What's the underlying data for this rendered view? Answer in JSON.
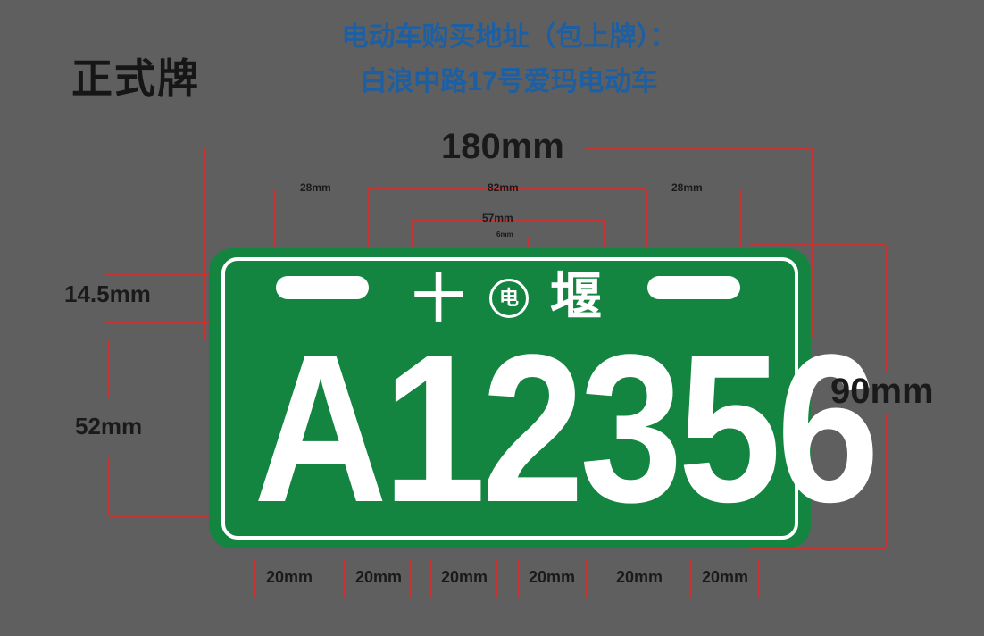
{
  "header": {
    "title": "正式牌",
    "banner_line1": "电动车购买地址（包上牌）：",
    "banner_line2": "白浪中路17号爱玛电动车"
  },
  "dimensions": {
    "width_total": "180mm",
    "height_total": "90mm",
    "slot_left": "28mm",
    "slot_gap": "82mm",
    "slot_right": "28mm",
    "top_text_span": "57mm",
    "circle_width": "6mm",
    "top_margin": "14.5mm",
    "char_height": "52mm",
    "char_widths": [
      "20mm",
      "20mm",
      "20mm",
      "20mm",
      "20mm",
      "20mm"
    ]
  },
  "plate": {
    "top_left_char": "十",
    "circle_char": "电",
    "top_right_char": "堰",
    "number": "A12356",
    "background_color": "#138540",
    "text_color": "#ffffff"
  },
  "colors": {
    "background": "#5f5f5f",
    "dimension_line": "#c83232",
    "banner": "#1d5fa3"
  }
}
